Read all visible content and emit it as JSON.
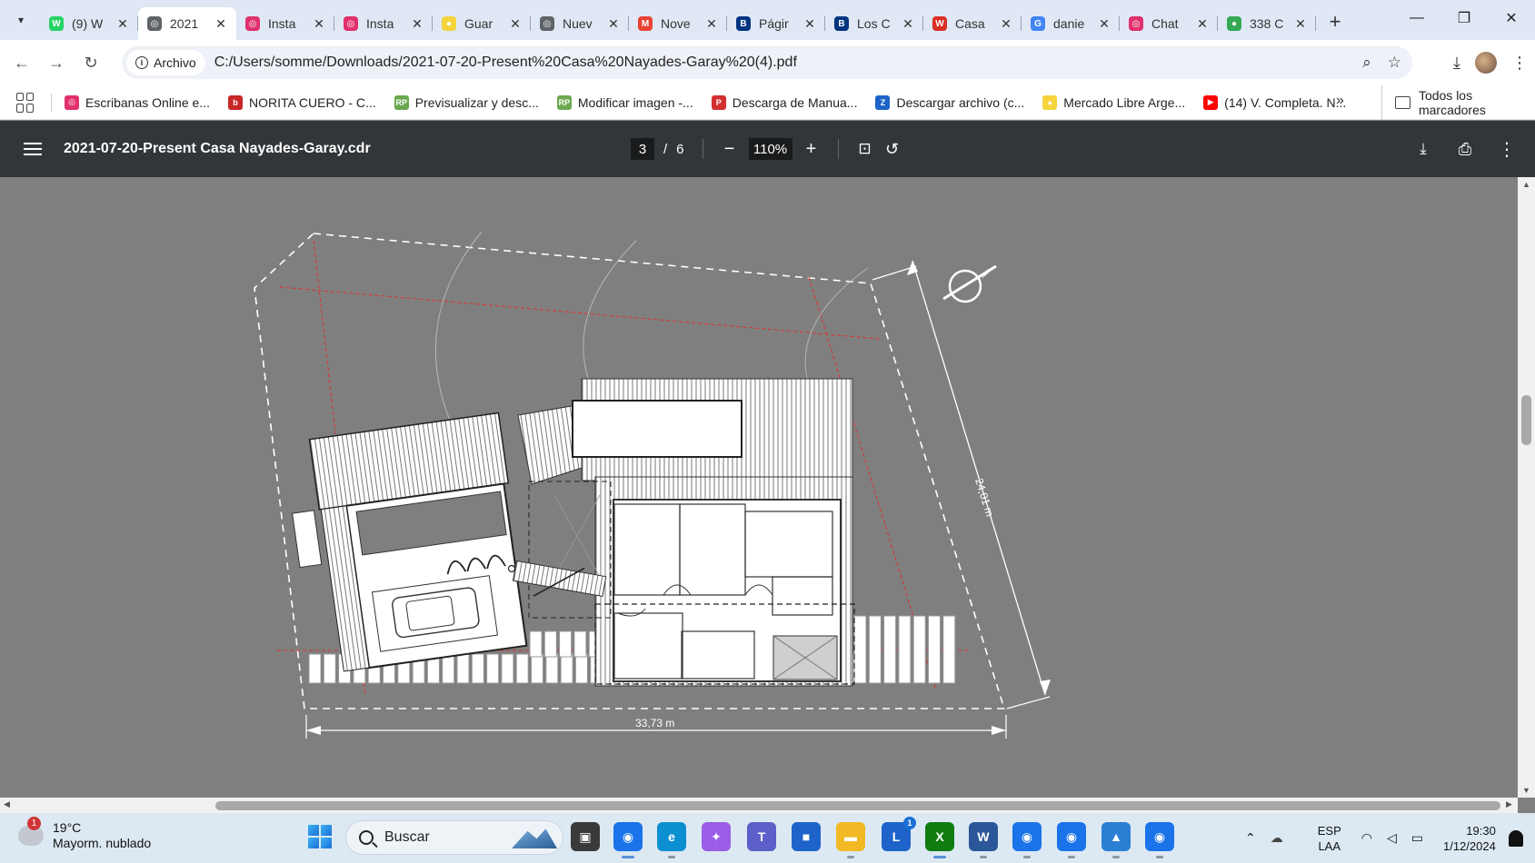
{
  "browser": {
    "tabs": [
      {
        "title": "(9) W",
        "icon": "whatsapp-icon",
        "color": "#25d366",
        "glyph": "W"
      },
      {
        "title": "2021",
        "icon": "globe-icon",
        "color": "#5f6368",
        "glyph": "◎",
        "active": true
      },
      {
        "title": "Insta",
        "icon": "instagram-icon",
        "color": "#e1306c",
        "glyph": "◎"
      },
      {
        "title": "Insta",
        "icon": "instagram-icon",
        "color": "#e1306c",
        "glyph": "◎"
      },
      {
        "title": "Guar",
        "icon": "mercadolibre-icon",
        "color": "#f5d33a",
        "glyph": "●"
      },
      {
        "title": "Nuev",
        "icon": "chrome-icon",
        "color": "#5f6368",
        "glyph": "◎"
      },
      {
        "title": "Nove",
        "icon": "gmail-icon",
        "color": "#ea4335",
        "glyph": "M"
      },
      {
        "title": "Págir",
        "icon": "booking-icon",
        "color": "#003580",
        "glyph": "B"
      },
      {
        "title": "Los C",
        "icon": "booking-icon",
        "color": "#003580",
        "glyph": "B"
      },
      {
        "title": "Casa",
        "icon": "red-logo-icon",
        "color": "#d93025",
        "glyph": "W"
      },
      {
        "title": "danie",
        "icon": "google-icon",
        "color": "#4285f4",
        "glyph": "G"
      },
      {
        "title": "Chat",
        "icon": "instagram-icon",
        "color": "#e1306c",
        "glyph": "◎"
      },
      {
        "title": "338 C",
        "icon": "maps-icon",
        "color": "#34a853",
        "glyph": "●"
      }
    ],
    "omnibox": {
      "chip_label": "Archivo",
      "url": "C:/Users/somme/Downloads/2021-07-20-Present%20Casa%20Nayades-Garay%20(4).pdf"
    },
    "bookmarks": [
      {
        "label": "Escribanas Online e...",
        "icon": "instagram-icon",
        "color": "#e1306c",
        "glyph": "◎"
      },
      {
        "label": "NORITA CUERO - C...",
        "icon": "b-logo-icon",
        "color": "#c62828",
        "glyph": "b"
      },
      {
        "label": "Previsualizar y desc...",
        "icon": "rp-icon",
        "color": "#6aa84f",
        "glyph": "RP"
      },
      {
        "label": "Modificar imagen -...",
        "icon": "rp-icon",
        "color": "#6aa84f",
        "glyph": "RP"
      },
      {
        "label": "Descarga de Manua...",
        "icon": "psh-icon",
        "color": "#d32f2f",
        "glyph": "P"
      },
      {
        "label": "Descargar archivo (c...",
        "icon": "z-icon",
        "color": "#1e63c9",
        "glyph": "Z"
      },
      {
        "label": "Mercado Libre Arge...",
        "icon": "mercadolibre-icon",
        "color": "#f5d33a",
        "glyph": "●"
      },
      {
        "label": "(14) V. Completa. N...",
        "icon": "youtube-icon",
        "color": "#ff0000",
        "glyph": "▶"
      }
    ],
    "all_bookmarks_label": "Todos los marcadores"
  },
  "pdf": {
    "filename": "2021-07-20-Present Casa Nayades-Garay.cdr",
    "page_current": "3",
    "page_separator": "/",
    "page_total": "6",
    "zoom": "110%"
  },
  "drawing": {
    "dim_width": "33,73 m",
    "dim_depth": "24,01 m"
  },
  "taskbar": {
    "weather_temp": "19°C",
    "weather_desc": "Mayorm. nublado",
    "weather_badge": "1",
    "search_placeholder": "Buscar",
    "lang_top": "ESP",
    "lang_bottom": "LAA",
    "time": "19:30",
    "date": "1/12/2024",
    "apps": [
      {
        "name": "taskview-icon",
        "glyph": "▣",
        "color": "#3a3a3a"
      },
      {
        "name": "chrome-icon",
        "glyph": "◉",
        "color": "#1a73e8",
        "state": "active"
      },
      {
        "name": "edge-icon",
        "glyph": "e",
        "color": "#0c8fd0",
        "state": "running"
      },
      {
        "name": "copilot-icon",
        "glyph": "✦",
        "color": "#9b5de5"
      },
      {
        "name": "teams-icon",
        "glyph": "T",
        "color": "#5b5fc7"
      },
      {
        "name": "store-icon",
        "glyph": "■",
        "color": "#1e63c9"
      },
      {
        "name": "explorer-icon",
        "glyph": "▬",
        "color": "#f2b925",
        "state": "running"
      },
      {
        "name": "l-app-icon",
        "glyph": "L",
        "color": "#1e63c9",
        "badge": "1"
      },
      {
        "name": "xbox-icon",
        "glyph": "X",
        "color": "#107c10",
        "state": "active"
      },
      {
        "name": "word-icon",
        "glyph": "W",
        "color": "#2b579a",
        "state": "running"
      },
      {
        "name": "chrome-profile-icon",
        "glyph": "◉",
        "color": "#1a73e8",
        "state": "running"
      },
      {
        "name": "chrome-profile-icon",
        "glyph": "◉",
        "color": "#1a73e8",
        "state": "running"
      },
      {
        "name": "photos-icon",
        "glyph": "▲",
        "color": "#2a7fd4",
        "state": "running"
      },
      {
        "name": "chrome-profile-icon",
        "glyph": "◉",
        "color": "#1a73e8",
        "state": "running"
      }
    ]
  }
}
